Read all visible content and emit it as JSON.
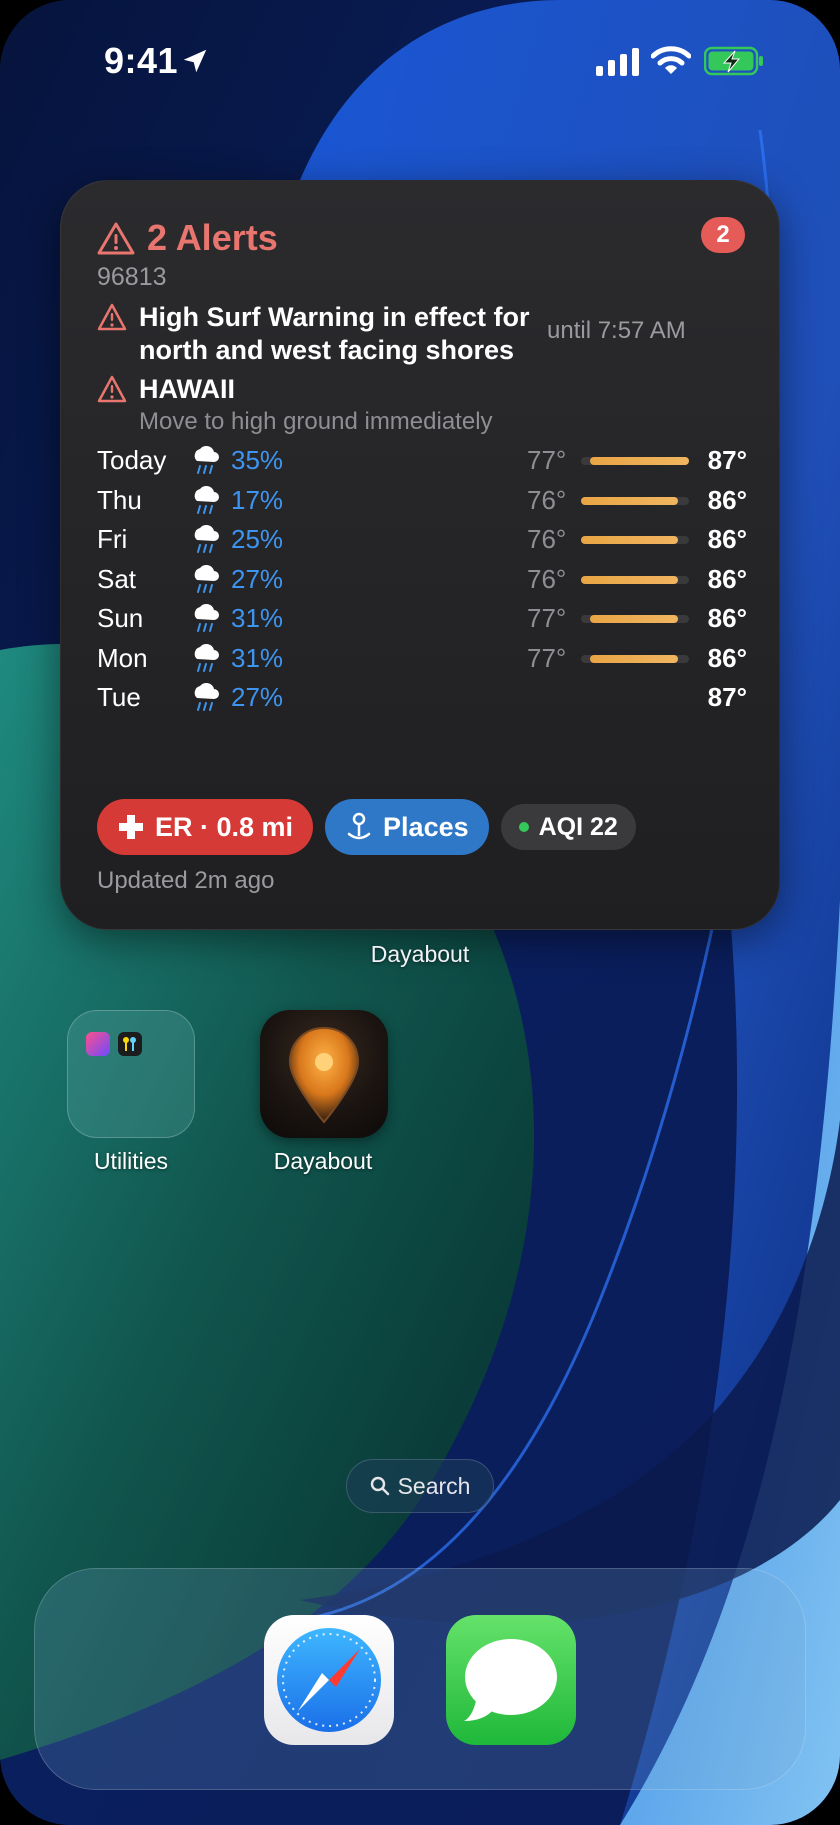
{
  "status_bar": {
    "time": "9:41"
  },
  "widget": {
    "alert_title": "2 Alerts",
    "badge_count": "2",
    "zip": "96813",
    "alerts": [
      {
        "title_line1": "High Surf Warning in effect for",
        "title_line2": "north and west facing shores",
        "until": "until 7:57 AM"
      },
      {
        "title_line1": "HAWAII",
        "subtitle": "Move to high ground immediately"
      }
    ],
    "forecast": [
      {
        "day": "Today",
        "precip": "35%",
        "low": "77°",
        "high": "87°",
        "range_start": 0.08,
        "range_end": 1.0,
        "icon": "rain-cloud-icon"
      },
      {
        "day": "Thu",
        "precip": "17%",
        "low": "76°",
        "high": "86°",
        "range_start": 0.0,
        "range_end": 0.9,
        "icon": "rain-cloud-icon"
      },
      {
        "day": "Fri",
        "precip": "25%",
        "low": "76°",
        "high": "86°",
        "range_start": 0.0,
        "range_end": 0.9,
        "icon": "rain-cloud-icon"
      },
      {
        "day": "Sat",
        "precip": "27%",
        "low": "76°",
        "high": "86°",
        "range_start": 0.0,
        "range_end": 0.9,
        "icon": "rain-cloud-icon"
      },
      {
        "day": "Sun",
        "precip": "31%",
        "low": "77°",
        "high": "86°",
        "range_start": 0.08,
        "range_end": 0.9,
        "icon": "rain-cloud-icon"
      },
      {
        "day": "Mon",
        "precip": "31%",
        "low": "77°",
        "high": "86°",
        "range_start": 0.08,
        "range_end": 0.9,
        "icon": "rain-cloud-icon"
      },
      {
        "day": "Tue",
        "precip": "27%",
        "low": "",
        "high": "87°",
        "icon": "rain-cloud-icon"
      }
    ],
    "chips": {
      "er": "ER · 0.8 mi",
      "places": "Places",
      "aqi": "AQI 22"
    },
    "updated": "Updated 2m ago",
    "label": "Dayabout"
  },
  "apps": {
    "folder_label": "Utilities",
    "dayabout_label": "Dayabout"
  },
  "search": {
    "label": "Search"
  },
  "colors": {
    "alert_red": "#e8766f",
    "precip_blue": "#3d95f0",
    "temp_bar": "#e9a545",
    "er_red": "#d63a37",
    "places_blue": "#2f78c7"
  }
}
